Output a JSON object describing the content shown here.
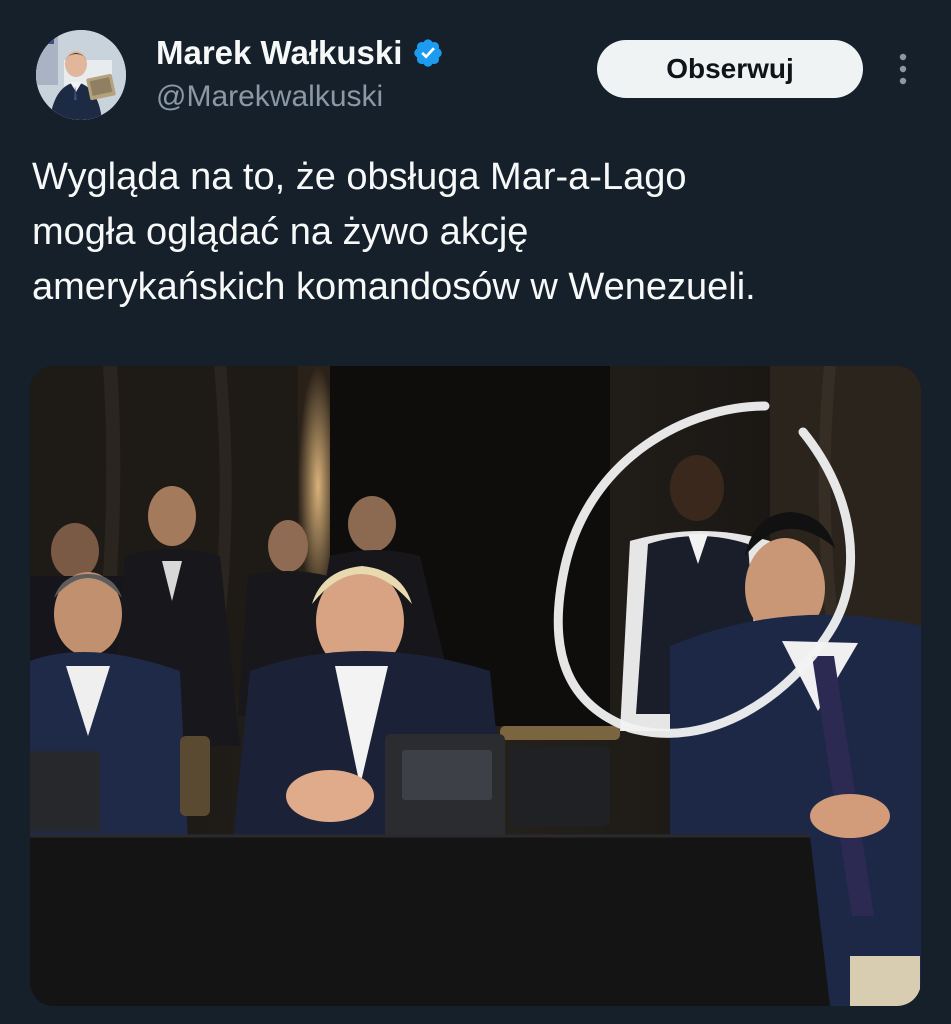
{
  "author": {
    "display_name": "Marek Wałkuski",
    "handle": "@Marekwalkuski",
    "verified": true
  },
  "actions": {
    "follow_label": "Obserwuj"
  },
  "tweet": {
    "text_lines": [
      "Wygląda na to, że obsługa Mar-a-Lago",
      "mogła oglądać na żywo akcję",
      "amerykańskich komandosów w Wenezueli."
    ]
  },
  "icons": {
    "verified": "verified-badge-icon",
    "more": "more-vertical-icon"
  },
  "colors": {
    "background": "#15202b",
    "text_primary": "#f7f9f9",
    "text_secondary": "#8b98a5",
    "follow_button_bg": "#eff3f4",
    "verified_blue": "#1d9bf0",
    "annotation_circle": "#f2f2f2"
  }
}
